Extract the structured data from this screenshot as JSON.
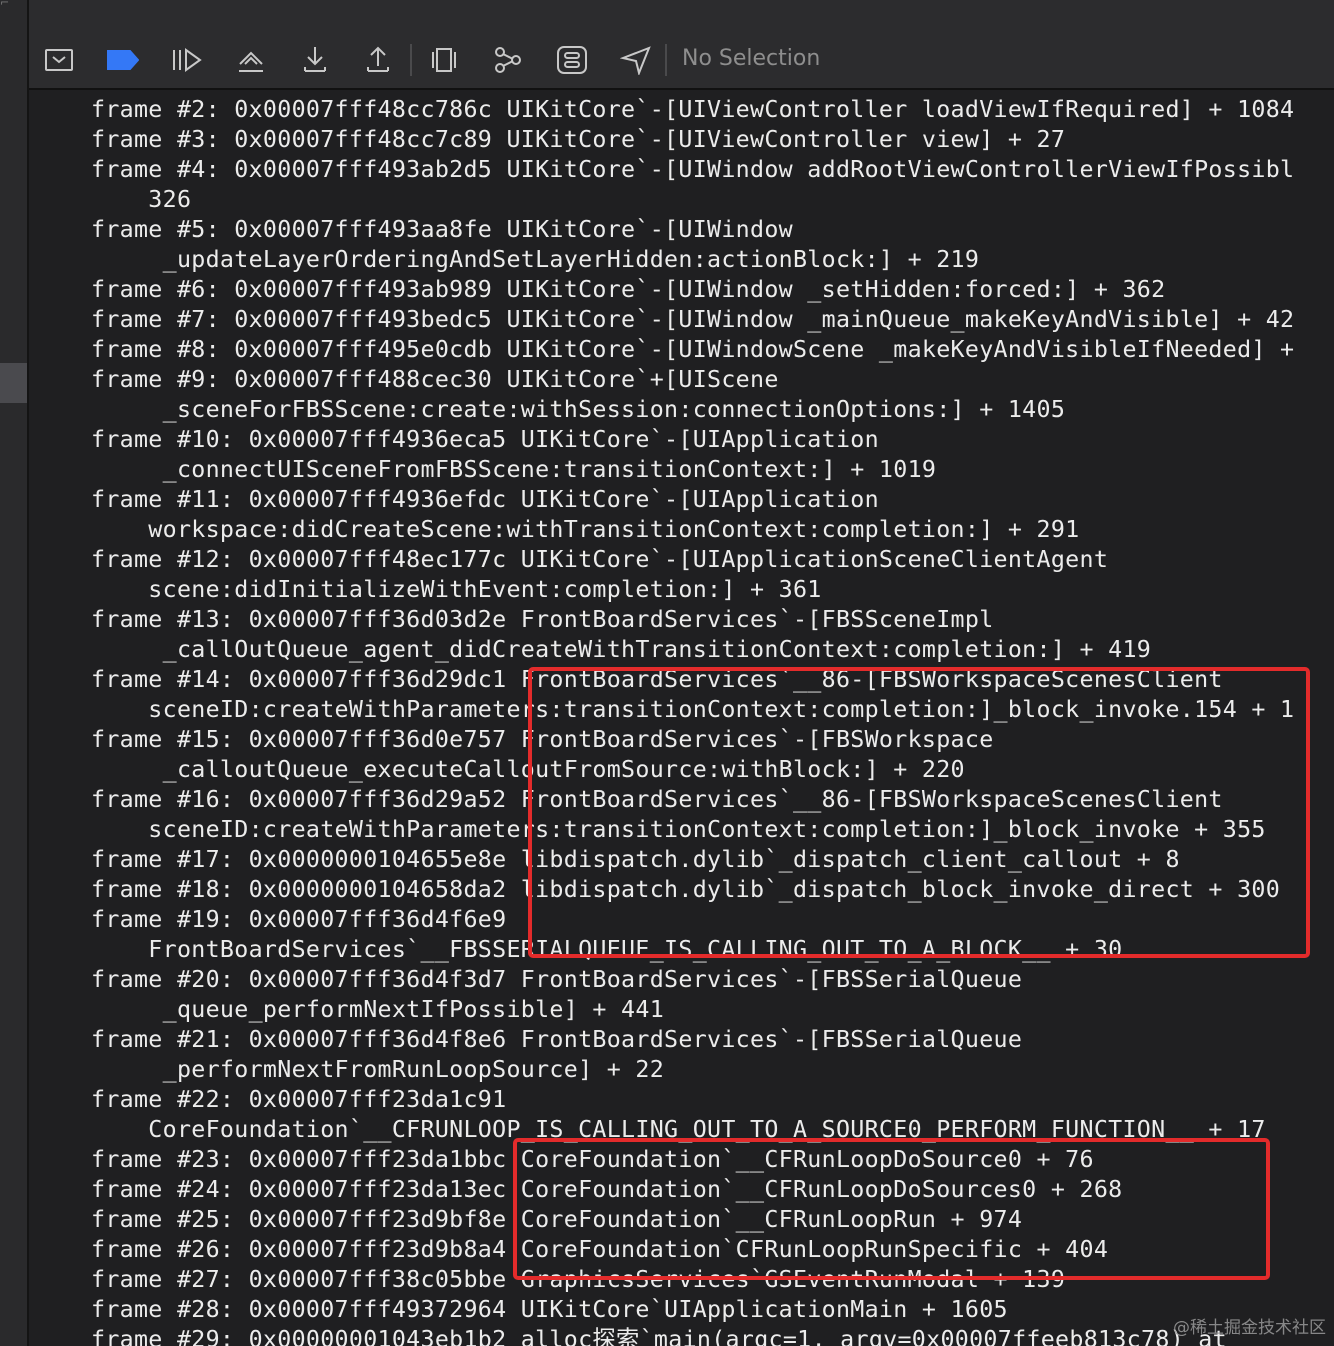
{
  "toolbar": {
    "items": [
      {
        "name": "hide-console-button",
        "icon": "console-toggle-icon"
      },
      {
        "name": "breakpoints-toggle-button",
        "icon": "breakpoint-icon",
        "color": "#3478f6"
      },
      {
        "name": "continue-button",
        "icon": "continue-icon"
      },
      {
        "name": "step-over-button",
        "icon": "step-over-icon"
      },
      {
        "name": "step-into-button",
        "icon": "step-into-icon"
      },
      {
        "name": "step-out-button",
        "icon": "step-out-icon"
      },
      {
        "name": "debug-view-hierarchy-button",
        "icon": "view-hierarchy-icon"
      },
      {
        "name": "memory-graph-button",
        "icon": "memory-graph-icon"
      },
      {
        "name": "environment-overrides-button",
        "icon": "environment-overrides-icon"
      },
      {
        "name": "simulate-location-button",
        "icon": "location-icon"
      }
    ],
    "selection_label": "No Selection"
  },
  "console": {
    "lines": [
      "frame #2: 0x00007fff48cc786c UIKitCore`-[UIViewController loadViewIfRequired] + 1084",
      "frame #3: 0x00007fff48cc7c89 UIKitCore`-[UIViewController view] + 27",
      "frame #4: 0x00007fff493ab2d5 UIKitCore`-[UIWindow addRootViewControllerViewIfPossibl",
      "    326",
      "frame #5: 0x00007fff493aa8fe UIKitCore`-[UIWindow",
      "     _updateLayerOrderingAndSetLayerHidden:actionBlock:] + 219",
      "frame #6: 0x00007fff493ab989 UIKitCore`-[UIWindow _setHidden:forced:] + 362",
      "frame #7: 0x00007fff493bedc5 UIKitCore`-[UIWindow _mainQueue_makeKeyAndVisible] + 42",
      "frame #8: 0x00007fff495e0cdb UIKitCore`-[UIWindowScene _makeKeyAndVisibleIfNeeded] +",
      "frame #9: 0x00007fff488cec30 UIKitCore`+[UIScene",
      "     _sceneForFBSScene:create:withSession:connectionOptions:] + 1405",
      "frame #10: 0x00007fff4936eca5 UIKitCore`-[UIApplication",
      "     _connectUISceneFromFBSScene:transitionContext:] + 1019",
      "frame #11: 0x00007fff4936efdc UIKitCore`-[UIApplication",
      "    workspace:didCreateScene:withTransitionContext:completion:] + 291",
      "frame #12: 0x00007fff48ec177c UIKitCore`-[UIApplicationSceneClientAgent",
      "    scene:didInitializeWithEvent:completion:] + 361",
      "frame #13: 0x00007fff36d03d2e FrontBoardServices`-[FBSSceneImpl",
      "     _callOutQueue_agent_didCreateWithTransitionContext:completion:] + 419",
      "frame #14: 0x00007fff36d29dc1 FrontBoardServices`__86-[FBSWorkspaceScenesClient",
      "    sceneID:createWithParameters:transitionContext:completion:]_block_invoke.154 + 1",
      "frame #15: 0x00007fff36d0e757 FrontBoardServices`-[FBSWorkspace",
      "     _calloutQueue_executeCalloutFromSource:withBlock:] + 220",
      "frame #16: 0x00007fff36d29a52 FrontBoardServices`__86-[FBSWorkspaceScenesClient",
      "    sceneID:createWithParameters:transitionContext:completion:]_block_invoke + 355",
      "frame #17: 0x0000000104655e8e libdispatch.dylib`_dispatch_client_callout + 8",
      "frame #18: 0x0000000104658da2 libdispatch.dylib`_dispatch_block_invoke_direct + 300",
      "frame #19: 0x00007fff36d4f6e9",
      "    FrontBoardServices`__FBSSERIALQUEUE_IS_CALLING_OUT_TO_A_BLOCK__ + 30",
      "frame #20: 0x00007fff36d4f3d7 FrontBoardServices`-[FBSSerialQueue",
      "     _queue_performNextIfPossible] + 441",
      "frame #21: 0x00007fff36d4f8e6 FrontBoardServices`-[FBSSerialQueue",
      "     _performNextFromRunLoopSource] + 22",
      "frame #22: 0x00007fff23da1c91",
      "    CoreFoundation`__CFRUNLOOP_IS_CALLING_OUT_TO_A_SOURCE0_PERFORM_FUNCTION__ + 17",
      "frame #23: 0x00007fff23da1bbc CoreFoundation`__CFRunLoopDoSource0 + 76",
      "frame #24: 0x00007fff23da13ec CoreFoundation`__CFRunLoopDoSources0 + 268",
      "frame #25: 0x00007fff23d9bf8e CoreFoundation`__CFRunLoopRun + 974",
      "frame #26: 0x00007fff23d9b8a4 CoreFoundation`CFRunLoopRunSpecific + 404",
      "frame #27: 0x00007fff38c05bbe GraphicsServices`GSEventRunModal + 139",
      "frame #28: 0x00007fff49372964 UIKitCore`UIApplicationMain + 1605",
      "frame #29: 0x00000001043eb1b2 alloc探索`main(argc=1, argv=0x00007ffeeb813c78) at"
    ],
    "highlight_color": "#e32b2b"
  },
  "watermark": "@稀土掘金技术社区"
}
